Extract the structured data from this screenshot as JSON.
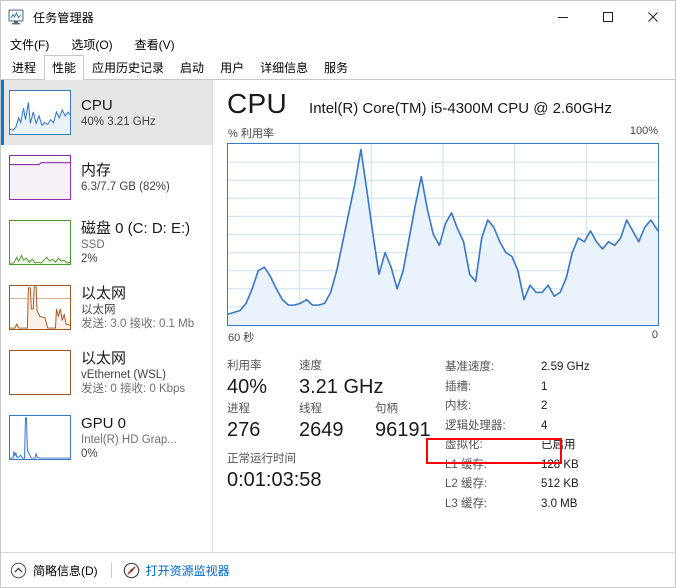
{
  "window": {
    "title": "任务管理器",
    "icon": "task-manager-icon",
    "controls": {
      "minimize": "最小化",
      "maximize": "最大化",
      "close": "关闭"
    }
  },
  "menu": {
    "items": [
      {
        "label": "文件(F)"
      },
      {
        "label": "选项(O)"
      },
      {
        "label": "查看(V)"
      }
    ]
  },
  "tabs": {
    "active_index": 1,
    "items": [
      {
        "label": "进程"
      },
      {
        "label": "性能"
      },
      {
        "label": "应用历史记录"
      },
      {
        "label": "启动"
      },
      {
        "label": "用户"
      },
      {
        "label": "详细信息"
      },
      {
        "label": "服务"
      }
    ]
  },
  "sidebar": {
    "items": [
      {
        "name": "cpu",
        "title": "CPU",
        "line2": "40% 3.21 GHz",
        "line3": "",
        "selected": true,
        "color": "#3b78c3",
        "fill": "#eaf3fb"
      },
      {
        "name": "memory",
        "title": "内存",
        "line2": "6.3/7.7 GB (82%)",
        "line3": "",
        "selected": false,
        "color": "#8b2fad",
        "fill": "#f6f0f8"
      },
      {
        "name": "disk-0",
        "title": "磁盘 0 (C: D: E:)",
        "line2": "SSD",
        "line3": "2%",
        "selected": false,
        "color": "#4a9b29",
        "fill": "#eef7e9"
      },
      {
        "name": "ethernet",
        "title": "以太网",
        "line2": "以太网",
        "line3": "发送: 3.0 接收: 0.1 Mb",
        "selected": false,
        "color": "#a6551a",
        "fill": "#fbf1e8"
      },
      {
        "name": "vethernet-wsl",
        "title": "以太网",
        "line2": "vEthernet (WSL)",
        "line3": "发送: 0 接收: 0 Kbps",
        "selected": false,
        "color": "#a6551a",
        "fill": "#fbf1e8"
      },
      {
        "name": "gpu-0",
        "title": "GPU 0",
        "line2": "Intel(R) HD Grap...",
        "line3": "0%",
        "selected": false,
        "color": "#3b78c3",
        "fill": "#eaf3fb"
      }
    ]
  },
  "main": {
    "heading": "CPU",
    "model": "Intel(R) Core(TM) i5-4300M CPU @ 2.60GHz",
    "graph": {
      "axis_label": "% 利用率",
      "axis_max": "100%",
      "time_left": "60 秒",
      "time_right": "0"
    },
    "stats_left": {
      "utilization_label": "利用率",
      "utilization_value": "40%",
      "speed_label": "速度",
      "speed_value": "3.21 GHz",
      "processes_label": "进程",
      "processes_value": "276",
      "threads_label": "线程",
      "threads_value": "2649",
      "handles_label": "句柄",
      "handles_value": "96191",
      "uptime_label": "正常运行时间",
      "uptime_value": "0:01:03:58"
    },
    "stats_right": [
      {
        "key": "基准速度:",
        "value": "2.59 GHz",
        "highlight": false
      },
      {
        "key": "插槽:",
        "value": "1",
        "highlight": false
      },
      {
        "key": "内核:",
        "value": "2",
        "highlight": false
      },
      {
        "key": "逻辑处理器:",
        "value": "4",
        "highlight": false
      },
      {
        "key": "虚拟化:",
        "value": "已启用",
        "highlight": true
      },
      {
        "key": "L1 缓存:",
        "value": "128 KB",
        "highlight": false
      },
      {
        "key": "L2 缓存:",
        "value": "512 KB",
        "highlight": false
      },
      {
        "key": "L3 缓存:",
        "value": "3.0 MB",
        "highlight": false
      }
    ],
    "annotation_color": "#ff0000"
  },
  "statusbar": {
    "collapse_label": "简略信息(D)",
    "collapse_icon": "chevron-up-circle-icon",
    "resource_monitor_label": "打开资源监视器",
    "resource_monitor_icon": "resource-monitor-icon",
    "link_color": "#0066cc"
  },
  "chart_data": {
    "type": "area",
    "title": "% 利用率",
    "xlabel": "",
    "ylabel": "% 利用率",
    "ylim": [
      0,
      100
    ],
    "xlim": [
      60,
      0
    ],
    "x_tick_labels": [
      "60 秒",
      "0"
    ],
    "y_tick_labels": [
      "100%"
    ],
    "grid": true,
    "line_color": "#3b78c3",
    "fill_color": "#eaf3fb",
    "series": [
      {
        "name": "CPU 利用率",
        "values": [
          6,
          7,
          8,
          12,
          20,
          30,
          32,
          27,
          20,
          14,
          11,
          11,
          12,
          14,
          11,
          11,
          12,
          18,
          30,
          46,
          62,
          78,
          97,
          74,
          50,
          28,
          40,
          32,
          20,
          30,
          48,
          66,
          82,
          64,
          50,
          44,
          56,
          60,
          52,
          44,
          24,
          48,
          58,
          54,
          46,
          40,
          38,
          30,
          16,
          22,
          18,
          18,
          22,
          16,
          18,
          26,
          40,
          48,
          44,
          52,
          46,
          44,
          42,
          50,
          56,
          46,
          42,
          52,
          58,
          54,
          48,
          52
        ]
      }
    ]
  }
}
